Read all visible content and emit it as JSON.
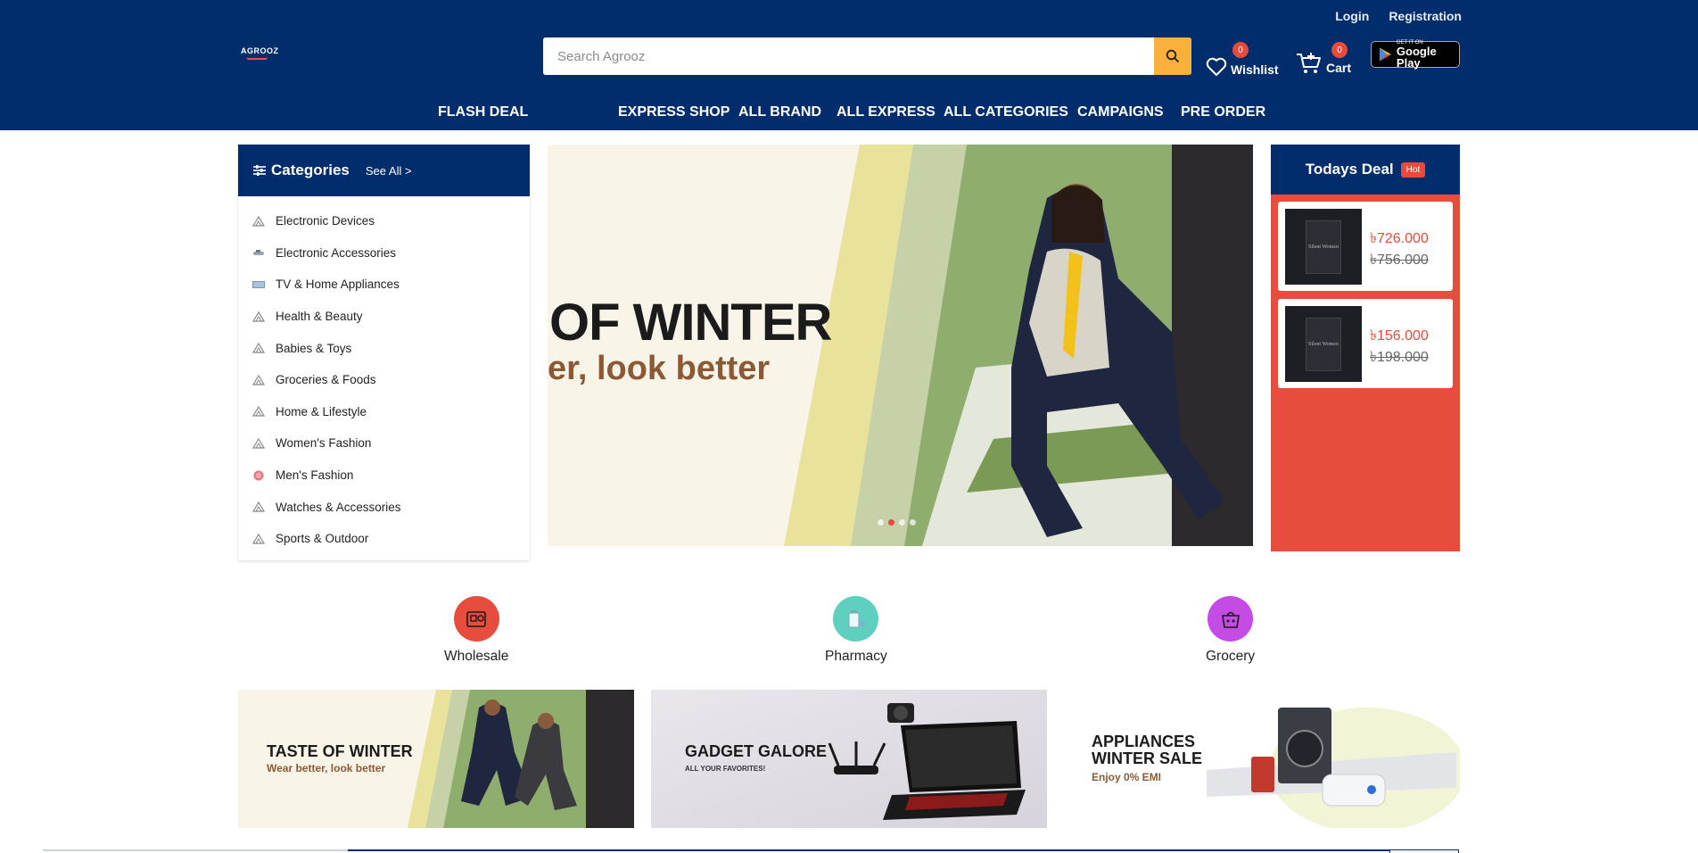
{
  "header": {
    "login": "Login",
    "registration": "Registration",
    "logo": "AGROOZ",
    "search_placeholder": "Search Agrooz",
    "wishlist_label": "Wishlist",
    "wishlist_count": "0",
    "cart_label": "Cart",
    "cart_count": "0",
    "gplay_small": "GET IT ON",
    "gplay_big": "Google Play"
  },
  "nav": {
    "items": [
      "FLASH DEAL",
      "EXPRESS SHOP",
      "ALL BRAND",
      "ALL EXPRESS",
      "ALL CATEGORIES",
      "CAMPAIGNS",
      "PRE ORDER"
    ]
  },
  "categories": {
    "title": "Categories",
    "see_all": "See All >",
    "items": [
      {
        "label": "Electronic Devices",
        "icon": "triangle-icon"
      },
      {
        "label": "Electronic Accessories",
        "icon": "accessory-icon"
      },
      {
        "label": "TV & Home Appliances",
        "icon": "tv-icon"
      },
      {
        "label": "Health & Beauty",
        "icon": "triangle-icon"
      },
      {
        "label": "Babies & Toys",
        "icon": "triangle-icon"
      },
      {
        "label": "Groceries & Foods",
        "icon": "triangle-icon"
      },
      {
        "label": "Home & Lifestyle",
        "icon": "triangle-icon"
      },
      {
        "label": "Women's Fashion",
        "icon": "triangle-icon"
      },
      {
        "label": "Men's Fashion",
        "icon": "ball-icon"
      },
      {
        "label": "Watches & Accessories",
        "icon": "triangle-icon"
      },
      {
        "label": "Sports & Outdoor",
        "icon": "triangle-icon"
      }
    ]
  },
  "hero": {
    "headline": "OF WINTER",
    "subline": "er, look better",
    "active_slide": 2,
    "slide_count": 4
  },
  "deal": {
    "title": "Todays Deal",
    "badge": "Hot",
    "products": [
      {
        "price": "৳726.000",
        "old_price": "৳756.000",
        "cover_text": "Silent Women"
      },
      {
        "price": "৳156.000",
        "old_price": "৳198.000",
        "cover_text": "Silent Women"
      }
    ]
  },
  "services": [
    {
      "label": "Wholesale",
      "color": "#e84c3d"
    },
    {
      "label": "Pharmacy",
      "color": "#5fd0c0"
    },
    {
      "label": "Grocery",
      "color": "#c44be3"
    }
  ],
  "banners": [
    {
      "title": "TASTE OF WINTER",
      "subtitle": "Wear better, look better"
    },
    {
      "title": "GADGET GALORE",
      "subtitle": "ALL YOUR FAVORITES!"
    },
    {
      "title_line1": "APPLIANCES",
      "title_line2": "WINTER SALE",
      "subtitle": "Enjoy 0% EMI"
    }
  ],
  "colors": {
    "primary": "#022d6d",
    "accent": "#e84c3d",
    "search_button": "#fbb03b"
  }
}
